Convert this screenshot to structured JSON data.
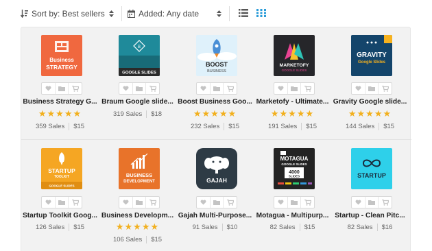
{
  "toolbar": {
    "sort_label": "Sort by: Best sellers",
    "added_label": "Added: Any date"
  },
  "colors": {
    "star": "#f2b01e",
    "grid_active": "#2b9cd8"
  },
  "products": [
    {
      "title": "Business Strategy G...",
      "sales": "359 Sales",
      "price": "$15",
      "rating": 5,
      "thumb": {
        "line1": "Business",
        "line2": "STRATEGY"
      }
    },
    {
      "title": "Braum Google slide...",
      "sales": "319 Sales",
      "price": "$18",
      "rating": 0,
      "thumb": {
        "line1": "GOOGLE SLIDES"
      }
    },
    {
      "title": "Boost Business Goo...",
      "sales": "232 Sales",
      "price": "$15",
      "rating": 5,
      "thumb": {
        "line1": "BOOST",
        "line2": "BUSINESS"
      }
    },
    {
      "title": "Marketofy - Ultimate...",
      "sales": "191 Sales",
      "price": "$15",
      "rating": 5,
      "thumb": {
        "line1": "MARKETOFY",
        "line2": "GOOGLE SLIDES"
      }
    },
    {
      "title": "Gravity Google slide...",
      "sales": "144 Sales",
      "price": "$15",
      "rating": 5,
      "thumb": {
        "line1": "GRAVITY",
        "line2": "Google Slides"
      }
    },
    {
      "title": "Startup Toolkit Goog...",
      "sales": "126 Sales",
      "price": "$15",
      "rating": 0,
      "thumb": {
        "line1": "STARTUP",
        "line2": "TOOLKIT",
        "line3": "GOOGLE SLIDES"
      }
    },
    {
      "title": "Business Developm...",
      "sales": "106 Sales",
      "price": "$15",
      "rating": 5,
      "thumb": {
        "line1": "BUSINESS",
        "line2": "DEVELOPMENT"
      }
    },
    {
      "title": "Gajah Multi-Purpose...",
      "sales": "91 Sales",
      "price": "$10",
      "rating": 0,
      "thumb": {
        "line1": "GAJAH"
      }
    },
    {
      "title": "Motagua - Multipurp...",
      "sales": "82 Sales",
      "price": "$15",
      "rating": 0,
      "thumb": {
        "line1": "MOTAGUA",
        "line2": "GOOGLE SLIDES",
        "line3": "4000",
        "line4": "SLIDES"
      }
    },
    {
      "title": "Startup - Clean Pitc...",
      "sales": "82 Sales",
      "price": "$16",
      "rating": 0,
      "thumb": {
        "line1": "STARTUP"
      }
    }
  ]
}
